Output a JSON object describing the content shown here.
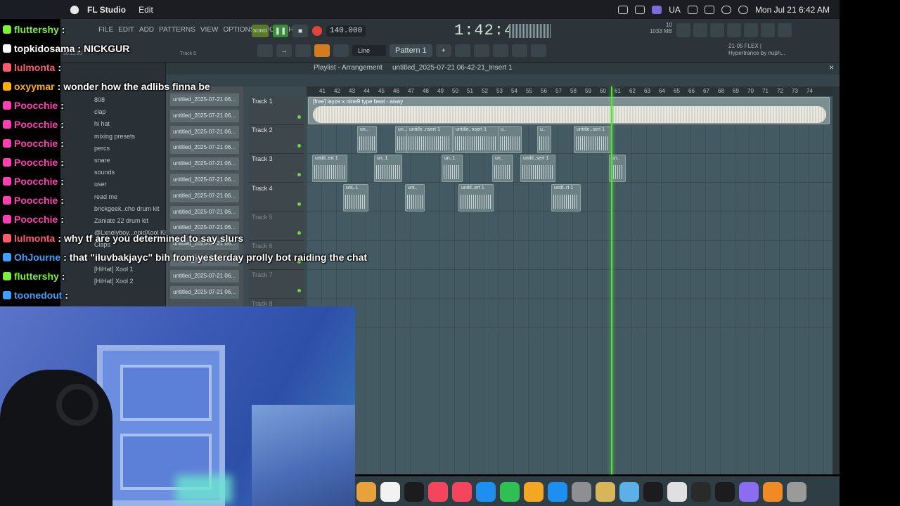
{
  "menubar": {
    "app_name": "FL Studio",
    "menu_edit": "Edit",
    "input_source": "UA",
    "datetime": "Mon Jul 21  6:42 AM"
  },
  "fl_toolbar": {
    "menus": [
      "FILE",
      "EDIT",
      "ADD",
      "PATTERNS",
      "VIEW",
      "OPTIONS",
      "TOOLS",
      "HELP"
    ],
    "song_label": "SONG",
    "tempo": "140.000",
    "time": "1:42:47",
    "cpu": "10",
    "memory": "1033 MB",
    "hint_track": "Track 5",
    "hint_time": "56:11:16",
    "snap": "Line",
    "pattern": "Pattern 1",
    "flex_line1": "21-05  FLEX |",
    "flex_line2": "Hypertrance by nuph..."
  },
  "browser": {
    "items": [
      "808",
      "clap",
      "hi hat",
      "mixing presets",
      "percs",
      "snare",
      "sounds",
      "user",
      "read me",
      "brickgeek..cho drum kit",
      "Zaniate 22 drum kit",
      "@Lxnelyboy...opidXool Kit",
      "Claps",
      "Hats",
      "[HiHat] Xool 1",
      "[HiHat] Xool 2"
    ]
  },
  "playlist": {
    "title": "Playlist - Arrangement",
    "project": "untitled_2025-07-21 06-42-21_Insert 1",
    "ruler_bars": [
      "41",
      "42",
      "43",
      "44",
      "45",
      "46",
      "47",
      "48",
      "49",
      "50",
      "51",
      "52",
      "53",
      "54",
      "55",
      "56",
      "57",
      "58",
      "59",
      "60",
      "61",
      "62",
      "63",
      "64",
      "65",
      "66",
      "67",
      "68",
      "69",
      "70",
      "71",
      "72",
      "73",
      "74"
    ],
    "picker_items": [
      "untitled_2025-07-21 06...",
      "untitled_2025-07-21 06...",
      "untitled_2025-07-21 06...",
      "untitled_2025-07-21 06...",
      "untitled_2025-07-21 06...",
      "untitled_2025-07-21 06...",
      "untitled_2025-07-21 06...",
      "untitled_2025-07-21 06...",
      "untitled_2025-07-21 06...",
      "untitled_2025-07-21 06...",
      "untitled_2025-07-21 06...",
      "untitled_2025-07-21 06...",
      "untitled_2025-07-21 06..."
    ],
    "tracks": [
      "Track 1",
      "Track 2",
      "Track 3",
      "Track 4",
      "Track 5",
      "Track 6",
      "Track 7",
      "Track 8"
    ],
    "main_clip": "[free] iayze x nine9 type beat - away",
    "track2_clips": [
      "un..",
      "un..",
      "untitle..nsert 1",
      "untitle..nsert 1",
      "u..",
      "u..",
      "untitle..sert 1"
    ],
    "track3_clips": [
      "untitl..ert 1",
      "un..1",
      "un..1",
      "un..",
      "untitl..sert 1",
      "un.."
    ],
    "track4_clips": [
      "unt..1",
      "unt..",
      "untitl..ert 1",
      "untit..rt 1"
    ]
  },
  "chat": [
    {
      "user": "fluttershy",
      "sep": ":",
      "msg": "",
      "color": "#7ef03a"
    },
    {
      "user": "topkidosama",
      "sep": ":",
      "msg": "NICKGUR",
      "color": "#ffffff"
    },
    {
      "user": "lulmonta",
      "sep": ":",
      "msg": "",
      "color": "#ff5b6e"
    },
    {
      "user": "oxyymar",
      "sep": ":",
      "msg": "wonder how the adlibs finna be",
      "color": "#ffb000"
    },
    {
      "user": "Poocchie",
      "sep": ":",
      "msg": "",
      "color": "#ff3fb4"
    },
    {
      "user": "Poocchie",
      "sep": ":",
      "msg": "",
      "color": "#ff3fb4"
    },
    {
      "user": "Poocchie",
      "sep": ":",
      "msg": "",
      "color": "#ff3fb4"
    },
    {
      "user": "Poocchie",
      "sep": ":",
      "msg": "",
      "color": "#ff3fb4"
    },
    {
      "user": "Poocchie",
      "sep": ":",
      "msg": "",
      "color": "#ff3fb4"
    },
    {
      "user": "Poocchie",
      "sep": ":",
      "msg": "",
      "color": "#ff3fb4"
    },
    {
      "user": "Poocchie",
      "sep": ":",
      "msg": "",
      "color": "#ff3fb4"
    },
    {
      "user": "lulmonta",
      "sep": ":",
      "msg": "why tf are you determined to say slurs",
      "color": "#ff5b6e"
    },
    {
      "user": "OhJourne",
      "sep": ":",
      "msg": "that \"iluvbakjayc\" bih from yesterday prolly bot raiding the chat",
      "color": "#3fa0ff"
    },
    {
      "user": "fluttershy",
      "sep": ":",
      "msg": "",
      "color": "#7ef03a"
    },
    {
      "user": "toonedout",
      "sep": ":",
      "msg": "",
      "color": "#3fa0ff"
    }
  ],
  "dock": {
    "apps": [
      "finder-icon",
      "freeform-icon",
      "apple-tv-icon",
      "music-icon",
      "news-icon",
      "keynote-icon",
      "numbers-icon",
      "pages-icon",
      "app-store-icon",
      "system-settings-icon",
      "notes-icon",
      "preview-icon",
      "logic-icon",
      "activity-icon",
      "obs-icon",
      "capcut-icon",
      "arc-icon",
      "fl-studio-icon",
      "trash-icon"
    ]
  }
}
